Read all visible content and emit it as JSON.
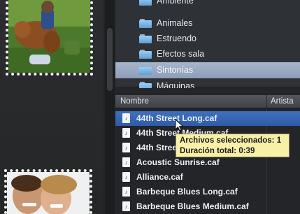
{
  "source_list": {
    "items": [
      {
        "label": "Ambiente",
        "icon": "folder-icon"
      },
      {
        "label": "Animales",
        "icon": "folder-icon"
      },
      {
        "label": "Estruendo",
        "icon": "folder-icon"
      },
      {
        "label": "Efectos sala",
        "icon": "folder-icon"
      },
      {
        "label": "Sintonías",
        "icon": "folder-icon",
        "selected": true
      },
      {
        "label": "Máquinas",
        "icon": "folder-icon"
      }
    ]
  },
  "file_list": {
    "columns": {
      "name": "Nombre",
      "artist": "Artista"
    },
    "rows": [
      {
        "label": "44th Street Long.caf",
        "selected": true
      },
      {
        "label": "44th Street Medium.caf"
      },
      {
        "label": "44th Street Short.caf"
      },
      {
        "label": "Acoustic Sunrise.caf"
      },
      {
        "label": "Alliance.caf"
      },
      {
        "label": "Barbeque Blues Long.caf"
      },
      {
        "label": "Barbeque Blues Medium.caf"
      }
    ]
  },
  "tooltip": {
    "line1": "Archivos seleccionados: 1",
    "line2": "Duración total: 0:39"
  },
  "colors": {
    "selection_blue": "#3568b4",
    "source_selection": "#9aaac4",
    "tooltip_bg": "#f7f0a6"
  }
}
